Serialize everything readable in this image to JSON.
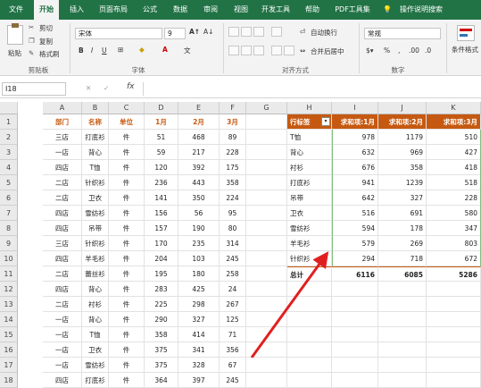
{
  "tabs": [
    {
      "label": "文件"
    },
    {
      "label": "开始",
      "active": true
    },
    {
      "label": "插入"
    },
    {
      "label": "页面布局"
    },
    {
      "label": "公式"
    },
    {
      "label": "数据"
    },
    {
      "label": "审阅"
    },
    {
      "label": "视图"
    },
    {
      "label": "开发工具"
    },
    {
      "label": "帮助"
    },
    {
      "label": "PDF工具集"
    },
    {
      "label": "操作说明搜索"
    }
  ],
  "ribbon": {
    "paste": "粘贴",
    "cut": "剪切",
    "copy": "复制",
    "painter": "格式刷",
    "clipboard": "剪贴板",
    "font_name": "宋体",
    "font_size": "9",
    "font_group": "字体",
    "wrap": "自动换行",
    "merge": "合并后居中",
    "align_group": "对齐方式",
    "number_format": "常规",
    "number_group": "数字",
    "conditional": "条件格式"
  },
  "formula_bar": {
    "name_box": "I18",
    "fx": "fx"
  },
  "columns": [
    "A",
    "B",
    "C",
    "D",
    "E",
    "F",
    "G",
    "H",
    "I",
    "J",
    "K"
  ],
  "rows": [
    "1",
    "2",
    "3",
    "4",
    "5",
    "6",
    "7",
    "8",
    "9",
    "10",
    "11",
    "12",
    "13",
    "14",
    "15",
    "16",
    "17",
    "18"
  ],
  "table": {
    "headers": [
      "部门",
      "名称",
      "单位",
      "1月",
      "2月",
      "3月"
    ],
    "rows": [
      [
        "三店",
        "打底衫",
        "件",
        "51",
        "468",
        "89"
      ],
      [
        "一店",
        "背心",
        "件",
        "59",
        "217",
        "228"
      ],
      [
        "四店",
        "T恤",
        "件",
        "120",
        "392",
        "175"
      ],
      [
        "二店",
        "针织衫",
        "件",
        "236",
        "443",
        "358"
      ],
      [
        "二店",
        "卫衣",
        "件",
        "141",
        "350",
        "224"
      ],
      [
        "四店",
        "雪纺衫",
        "件",
        "156",
        "56",
        "95"
      ],
      [
        "四店",
        "吊带",
        "件",
        "157",
        "190",
        "80"
      ],
      [
        "三店",
        "针织衫",
        "件",
        "170",
        "235",
        "314"
      ],
      [
        "四店",
        "羊毛衫",
        "件",
        "204",
        "103",
        "245"
      ],
      [
        "二店",
        "蕾丝衫",
        "件",
        "195",
        "180",
        "258"
      ],
      [
        "四店",
        "背心",
        "件",
        "283",
        "425",
        "24"
      ],
      [
        "二店",
        "衬衫",
        "件",
        "225",
        "298",
        "267"
      ],
      [
        "一店",
        "背心",
        "件",
        "290",
        "327",
        "125"
      ],
      [
        "一店",
        "T恤",
        "件",
        "358",
        "414",
        "71"
      ],
      [
        "一店",
        "卫衣",
        "件",
        "375",
        "341",
        "356"
      ],
      [
        "一店",
        "雪纺衫",
        "件",
        "375",
        "328",
        "67"
      ],
      [
        "四店",
        "打底衫",
        "件",
        "364",
        "397",
        "245"
      ]
    ]
  },
  "pivot": {
    "headers": [
      "行标签",
      "求和项:1月",
      "求和项:2月",
      "求和项:3月"
    ],
    "rows": [
      [
        "T恤",
        "978",
        "1179",
        "510"
      ],
      [
        "背心",
        "632",
        "969",
        "427"
      ],
      [
        "衬衫",
        "676",
        "358",
        "418"
      ],
      [
        "打底衫",
        "941",
        "1239",
        "518"
      ],
      [
        "吊带",
        "642",
        "327",
        "228"
      ],
      [
        "卫衣",
        "516",
        "691",
        "580"
      ],
      [
        "雪纺衫",
        "594",
        "178",
        "347"
      ],
      [
        "羊毛衫",
        "579",
        "269",
        "803"
      ],
      [
        "针织衫",
        "294",
        "718",
        "672"
      ]
    ],
    "total": [
      "总计",
      "6116",
      "6085",
      "5286"
    ]
  },
  "colors": {
    "brand": "#217346",
    "accent": "#c65911",
    "arrow": "#e02020"
  }
}
